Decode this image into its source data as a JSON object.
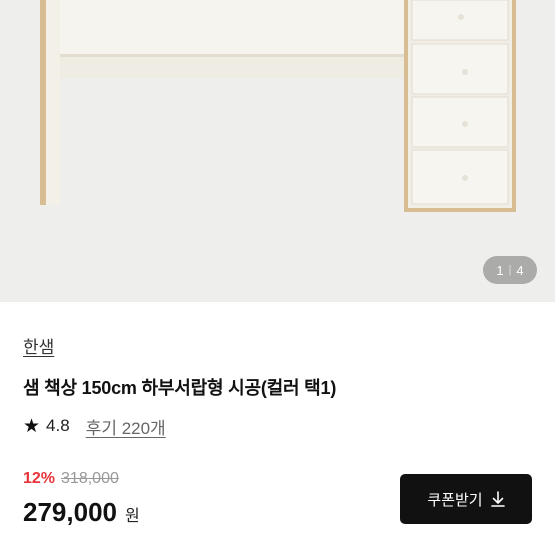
{
  "gallery": {
    "current_page": "1",
    "total_pages": "4",
    "separator": "|"
  },
  "product": {
    "brand": "한샘",
    "title": "샘 책상 150cm 하부서랍형 시공(컬러 택1)",
    "rating": "4.8",
    "reviews_label": "후기 220개"
  },
  "price": {
    "discount": "12%",
    "original": "318,000",
    "sale": "279,000",
    "currency": "원"
  },
  "coupon": {
    "label": "쿠폰받기"
  },
  "colors": {
    "discount_red": "#e8343a",
    "button_bg": "#111111",
    "hero_bg": "#eeeeec",
    "desk_white": "#f4f1e9",
    "wood_edge": "#d6b98c"
  },
  "icons": {
    "star": "star-icon",
    "download": "download-icon"
  }
}
